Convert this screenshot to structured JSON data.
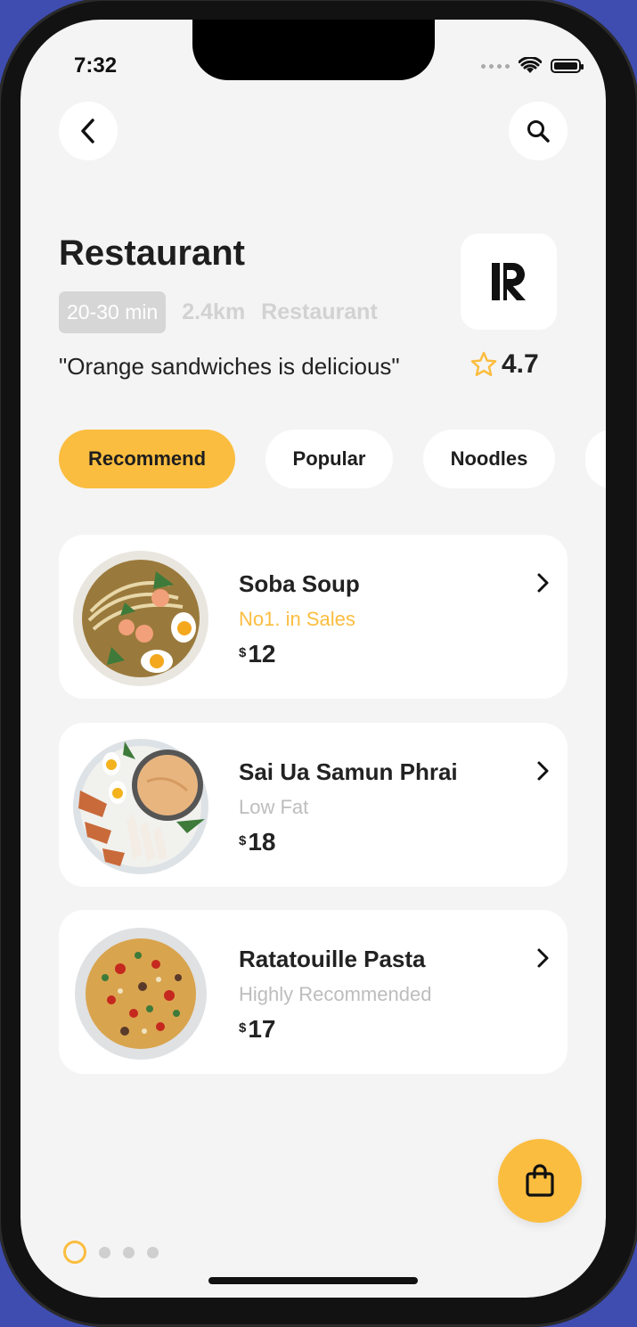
{
  "status": {
    "time": "7:32"
  },
  "restaurant": {
    "title": "Restaurant",
    "delivery_time": "20-30 min",
    "distance": "2.4km",
    "category": "Restaurant",
    "logo_letter": "R",
    "quote": "\"Orange sandwiches is delicious\"",
    "rating": "4.7"
  },
  "tabs": [
    {
      "label": "Recommend",
      "active": true
    },
    {
      "label": "Popular",
      "active": false
    },
    {
      "label": "Noodles",
      "active": false
    }
  ],
  "dishes": [
    {
      "name": "Soba Soup",
      "subtitle": "No1. in Sales",
      "currency": "$",
      "price": "12"
    },
    {
      "name": "Sai Ua Samun Phrai",
      "subtitle": "Low Fat",
      "currency": "$",
      "price": "18"
    },
    {
      "name": "Ratatouille Pasta",
      "subtitle": "Highly Recommended",
      "currency": "$",
      "price": "17"
    }
  ],
  "pager": {
    "total": 4,
    "active_index": 0
  },
  "colors": {
    "accent": "#fbbd3f",
    "background": "#f4f4f4",
    "card": "#ffffff"
  }
}
